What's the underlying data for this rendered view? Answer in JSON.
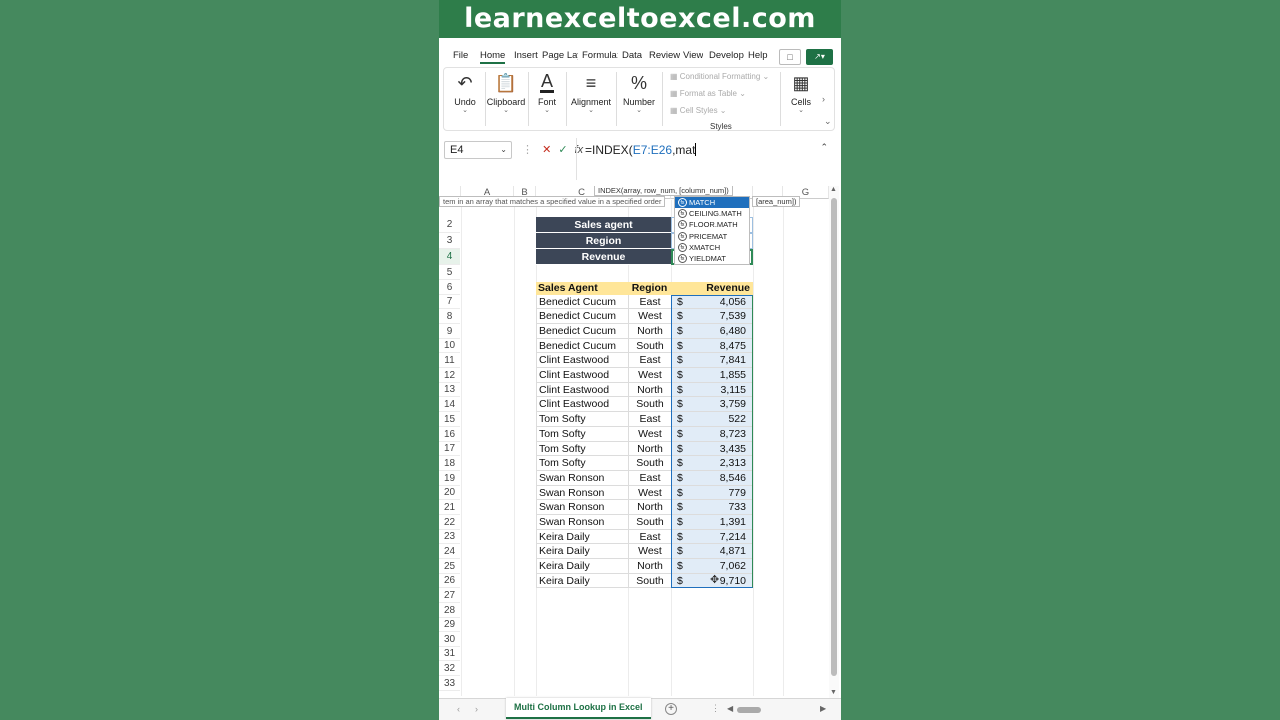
{
  "banner": "learnexceltoexcel.com",
  "menu": [
    "File",
    "Home",
    "Insert",
    "Page Lay",
    "Formula:",
    "Data",
    "Review",
    "View",
    "Develop(",
    "Help"
  ],
  "ribbon": {
    "undo": "Undo",
    "clipboard": "Clipboard",
    "font": "Font",
    "alignment": "Alignment",
    "number": "Number",
    "conditional_formatting": "Conditional Formatting",
    "format_as_table": "Format as Table",
    "cell_styles": "Cell Styles",
    "styles_group": "Styles",
    "cells": "Cells"
  },
  "formula_bar": {
    "name_box": "E4",
    "fx": "fx",
    "formula_prefix": "=INDEX(",
    "formula_ref": "E7:E26",
    "formula_suffix": ",mat"
  },
  "tooltip_syntax": "INDEX(array, row_num, [column_num])",
  "tooltip_area": "[area_num])",
  "tooltip_desc": "tem in an array that matches a specified value in a specified order",
  "autocomplete": [
    "MATCH",
    "CEILING.MATH",
    "FLOOR.MATH",
    "PRICEMAT",
    "XMATCH",
    "YIELDMAT"
  ],
  "columns": [
    "A",
    "B",
    "C",
    "G"
  ],
  "lookup_labels": [
    "Sales agent",
    "Region",
    "Revenue"
  ],
  "table_headers": [
    "Sales Agent",
    "Region",
    "Revenue"
  ],
  "currency_symbol": "$",
  "rows": [
    {
      "agent": "Benedict Cucum",
      "region": "East",
      "revenue": "4,056"
    },
    {
      "agent": "Benedict Cucum",
      "region": "West",
      "revenue": "7,539"
    },
    {
      "agent": "Benedict Cucum",
      "region": "North",
      "revenue": "6,480"
    },
    {
      "agent": "Benedict Cucum",
      "region": "South",
      "revenue": "8,475"
    },
    {
      "agent": "Clint Eastwood",
      "region": "East",
      "revenue": "7,841"
    },
    {
      "agent": "Clint Eastwood",
      "region": "West",
      "revenue": "1,855"
    },
    {
      "agent": "Clint Eastwood",
      "region": "North",
      "revenue": "3,115"
    },
    {
      "agent": "Clint Eastwood",
      "region": "South",
      "revenue": "3,759"
    },
    {
      "agent": "Tom Softy",
      "region": "East",
      "revenue": "522"
    },
    {
      "agent": "Tom Softy",
      "region": "West",
      "revenue": "8,723"
    },
    {
      "agent": "Tom Softy",
      "region": "North",
      "revenue": "3,435"
    },
    {
      "agent": "Tom Softy",
      "region": "South",
      "revenue": "2,313"
    },
    {
      "agent": "Swan Ronson",
      "region": "East",
      "revenue": "8,546"
    },
    {
      "agent": "Swan Ronson",
      "region": "West",
      "revenue": "779"
    },
    {
      "agent": "Swan Ronson",
      "region": "North",
      "revenue": "733"
    },
    {
      "agent": "Swan Ronson",
      "region": "South",
      "revenue": "1,391"
    },
    {
      "agent": "Keira Daily",
      "region": "East",
      "revenue": "7,214"
    },
    {
      "agent": "Keira Daily",
      "region": "West",
      "revenue": "4,871"
    },
    {
      "agent": "Keira Daily",
      "region": "North",
      "revenue": "7,062"
    },
    {
      "agent": "Keira Daily",
      "region": "South",
      "revenue": "9,710"
    }
  ],
  "row_numbers": [
    "2",
    "3",
    "4",
    "5",
    "6",
    "7",
    "8",
    "9",
    "10",
    "11",
    "12",
    "13",
    "14",
    "15",
    "16",
    "17",
    "18",
    "19",
    "20",
    "21",
    "22",
    "23",
    "24",
    "25",
    "26",
    "27",
    "28",
    "29",
    "30",
    "31",
    "32",
    "33"
  ],
  "sheet_tab": "Multi Column Lookup in Excel",
  "colors": {
    "brand_green": "#1e7145",
    "banner": "#2e7d4a",
    "dark_header": "#3c4657",
    "yellow_header": "#ffe699",
    "selection_blue": "#1f6fbd"
  }
}
